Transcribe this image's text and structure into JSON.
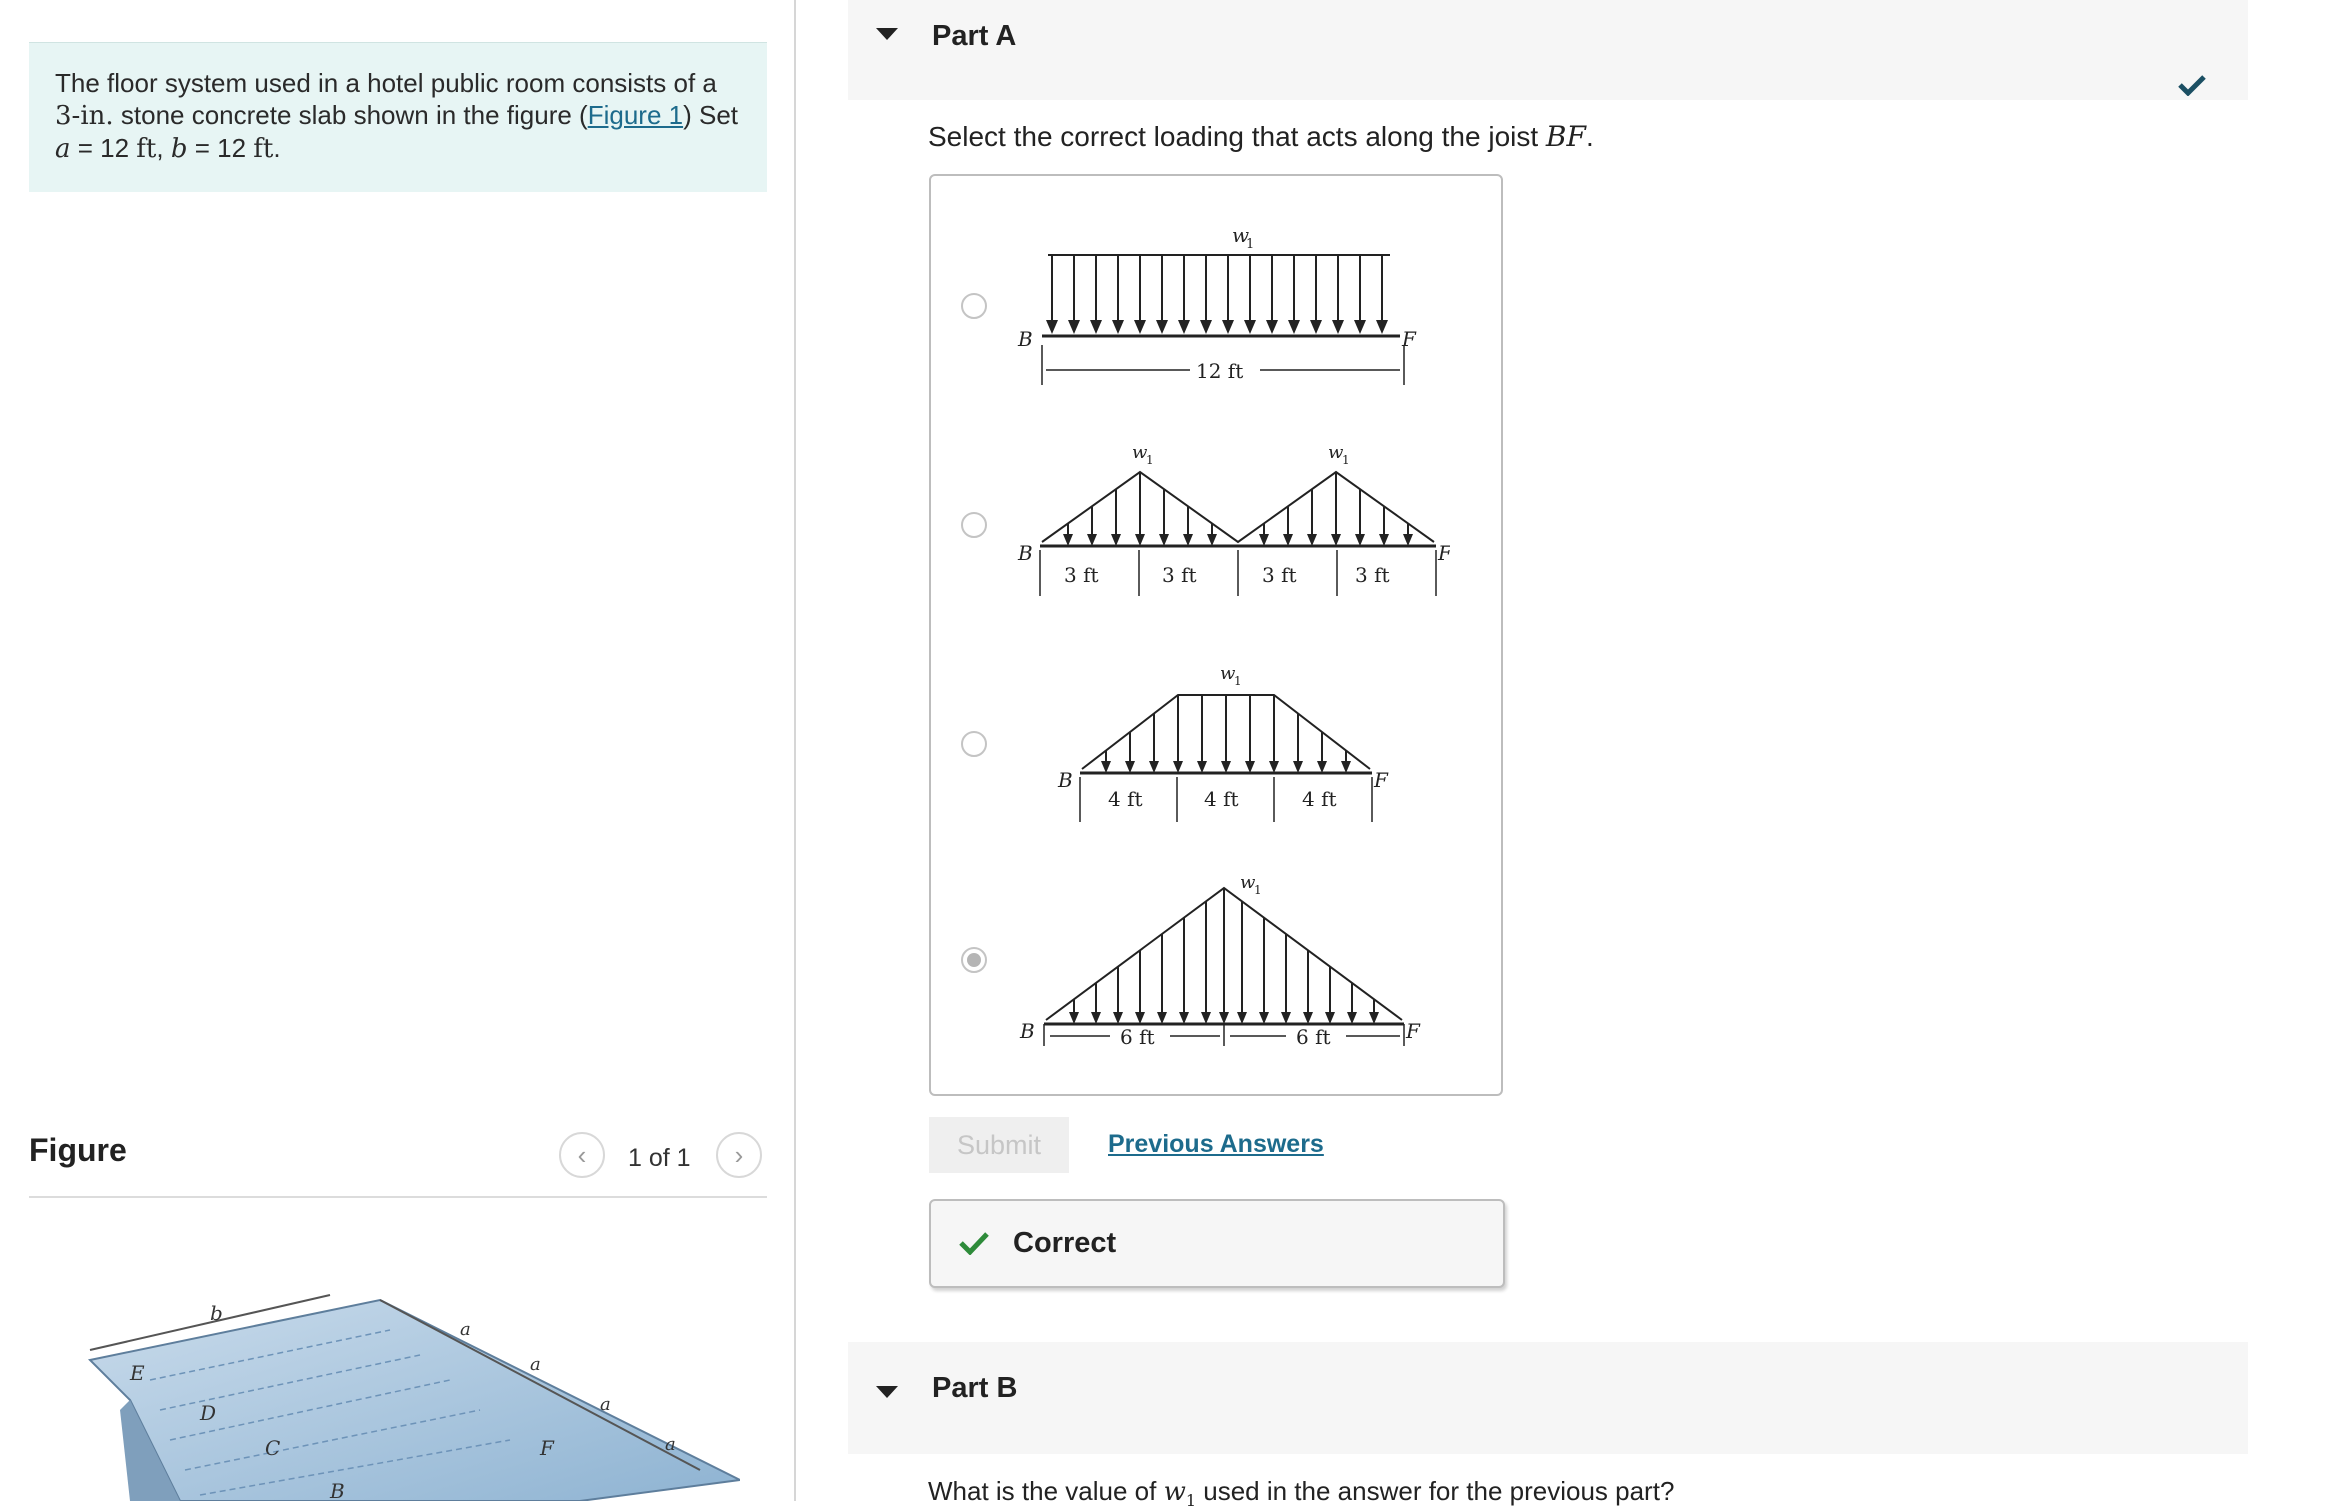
{
  "problem": {
    "text_before_link": "The floor system used in a hotel public room consists of a",
    "line2_thickness": "3-in.",
    "line2_text": " stone concrete slab shown in the figure (",
    "link_text": "Figure 1",
    "line2_after": ") Set",
    "var_a": "a",
    "eq1": " = 12 ",
    "unit_ft1": "ft",
    "comma": ", ",
    "var_b": "b",
    "eq2": " = 12 ",
    "unit_ft2": "ft",
    "period": "."
  },
  "figure_panel": {
    "title": "Figure",
    "counter": "1 of 1",
    "prev_glyph": "‹",
    "next_glyph": "›",
    "labels": {
      "b": "b",
      "a": "a",
      "E": "E",
      "D": "D",
      "C": "C",
      "F": "F",
      "B": "B"
    }
  },
  "partA": {
    "title": "Part A",
    "question_prefix": "Select the correct loading that acts along the joist ",
    "question_var": "BF",
    "question_suffix": ".",
    "options": [
      {
        "label_w": "w",
        "label_sub": "1",
        "left": "B",
        "right": "F",
        "dims": [
          "12 ft"
        ],
        "selected": false
      },
      {
        "label_w": "w",
        "label_sub": "1",
        "left": "B",
        "right": "F",
        "dims": [
          "3 ft",
          "3 ft",
          "3 ft",
          "3 ft"
        ],
        "selected": false
      },
      {
        "label_w": "w",
        "label_sub": "1",
        "left": "B",
        "right": "F",
        "dims": [
          "4 ft",
          "4 ft",
          "4 ft"
        ],
        "selected": false
      },
      {
        "label_w": "w",
        "label_sub": "1",
        "left": "B",
        "right": "F",
        "dims": [
          "6 ft",
          "6 ft"
        ],
        "selected": true
      }
    ],
    "submit_label": "Submit",
    "previous_answers_label": "Previous Answers",
    "feedback_label": "Correct"
  },
  "partB": {
    "title": "Part B",
    "question_prefix": "What is the value of ",
    "question_var": "w",
    "question_sub": "1",
    "question_suffix": " used in the answer for the previous part?"
  },
  "colors": {
    "accent_link": "#1d6b8c",
    "problem_bg": "#e7f5f4",
    "correct_green": "#2e8b3a",
    "check_blue": "#1b4f63"
  }
}
